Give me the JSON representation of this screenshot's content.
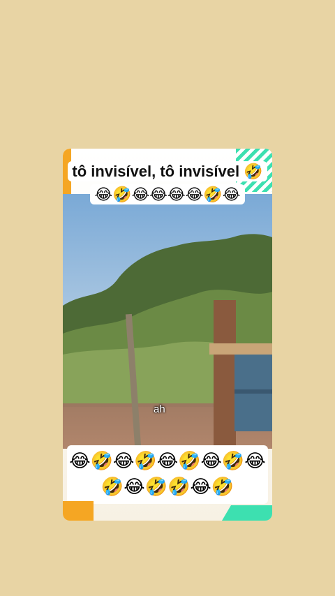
{
  "caption_top": "tô invisível, tô invisível 🤣😂🤣😂😂😂😂🤣😂",
  "subtitle": "ah",
  "caption_bottom": "😂🤣😂🤣😂🤣😂🤣😂🤣😂🤣🤣😂🤣"
}
